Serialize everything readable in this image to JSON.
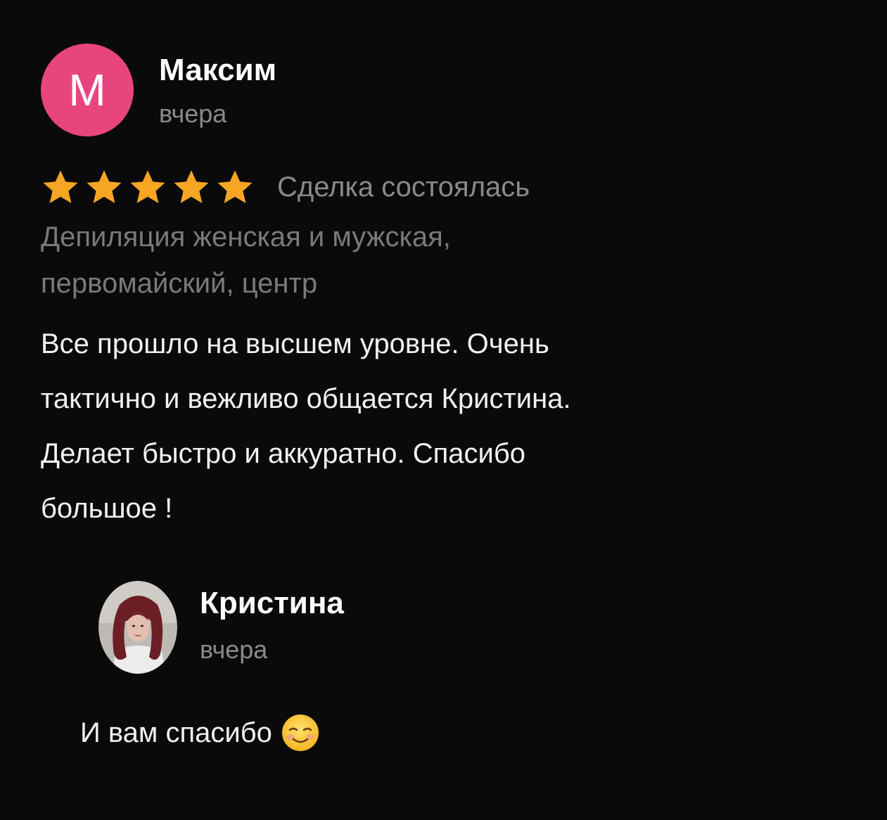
{
  "review": {
    "avatar_letter": "М",
    "avatar_color": "#e8457f",
    "author_name": "Максим",
    "date": "вчера",
    "rating": 5,
    "rating_max": 5,
    "star_color": "#f6a623",
    "deal_status": "Сделка состоялась",
    "service_line1": "Депиляция женская и мужская,",
    "service_line2": "первомайский, центр",
    "text_line1": "Все прошло на высшем уровне. Очень",
    "text_line2": "тактично и вежливо общается Кристина.",
    "text_line3": "Делает быстро и аккуратно. Спасибо",
    "text_line4": "большое !"
  },
  "reply": {
    "avatar_icon": "user-photo",
    "author_name": "Кристина",
    "date": "вчера",
    "text": "И вам спасибо",
    "emoji_icon": "smiling-face-emoji"
  }
}
